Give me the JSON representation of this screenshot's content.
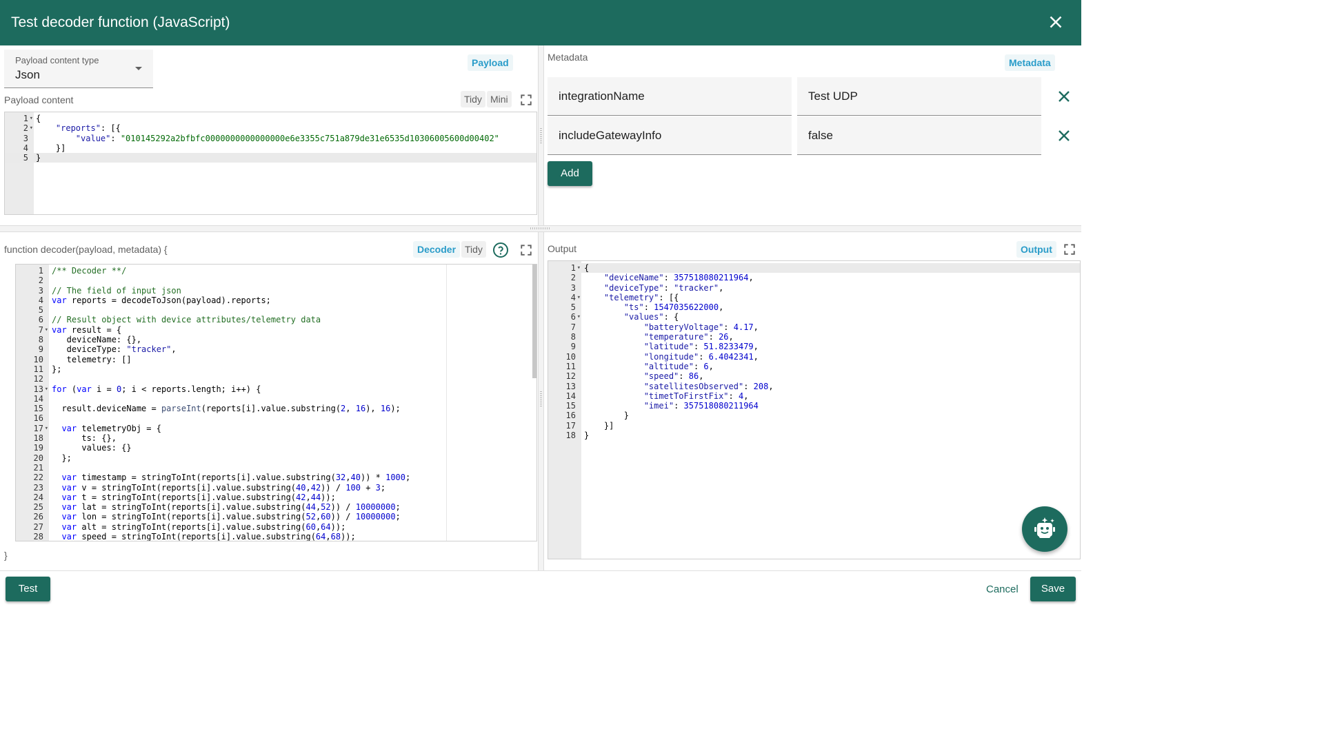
{
  "dialog": {
    "title": "Test decoder function (JavaScript)"
  },
  "payload": {
    "content_type_label": "Payload content type",
    "content_type_value": "Json",
    "chip": "Payload",
    "content_label": "Payload content",
    "tidy": "Tidy",
    "mini": "Mini",
    "line_numbers": [
      "1",
      "2",
      "3",
      "4",
      "5"
    ],
    "lines": [
      "{",
      "    \"reports\": [{",
      "        \"value\": \"010145292a2bfbfc0000000000000000e6e3355c751a879de31e6535d10306005600d00402\"",
      "    }]",
      "}"
    ]
  },
  "metadata": {
    "label": "Metadata",
    "chip": "Metadata",
    "rows": [
      {
        "key": "integrationName",
        "value": "Test UDP"
      },
      {
        "key": "includeGatewayInfo",
        "value": "false"
      }
    ],
    "add_label": "Add"
  },
  "decoder": {
    "signature": "function decoder(payload, metadata) {",
    "closing": "}",
    "chip": "Decoder",
    "tidy": "Tidy",
    "line_numbers": [
      "1",
      "2",
      "3",
      "4",
      "5",
      "6",
      "7",
      "8",
      "9",
      "10",
      "11",
      "12",
      "13",
      "14",
      "15",
      "16",
      "17",
      "18",
      "19",
      "20",
      "21",
      "22",
      "23",
      "24",
      "25",
      "26",
      "27",
      "28"
    ],
    "lines": [
      "/** Decoder **/",
      "",
      "// The field of input json",
      "var reports = decodeToJson(payload).reports;",
      "",
      "// Result object with device attributes/telemetry data",
      "var result = {",
      "   deviceName: {},",
      "   deviceType: \"tracker\",",
      "   telemetry: []",
      "};",
      "",
      "for (var i = 0; i < reports.length; i++) {",
      "",
      "  result.deviceName = parseInt(reports[i].value.substring(2, 16), 16);",
      "",
      "  var telemetryObj = {",
      "      ts: {},",
      "      values: {}",
      "  };",
      "",
      "  var timestamp = stringToInt(reports[i].value.substring(32,40)) * 1000;",
      "  var v = stringToInt(reports[i].value.substring(40,42)) / 100 + 3;",
      "  var t = stringToInt(reports[i].value.substring(42,44));",
      "  var lat = stringToInt(reports[i].value.substring(44,52)) / 10000000;",
      "  var lon = stringToInt(reports[i].value.substring(52,60)) / 10000000;",
      "  var alt = stringToInt(reports[i].value.substring(60,64));",
      "  var speed = stringToInt(reports[i].value.substring(64,68));"
    ]
  },
  "output": {
    "label": "Output",
    "chip": "Output",
    "line_numbers": [
      "1",
      "2",
      "3",
      "4",
      "5",
      "6",
      "7",
      "8",
      "9",
      "10",
      "11",
      "12",
      "13",
      "14",
      "15",
      "16",
      "17",
      "18"
    ],
    "lines": [
      "{",
      "    \"deviceName\": 357518080211964,",
      "    \"deviceType\": \"tracker\",",
      "    \"telemetry\": [{",
      "        \"ts\": 1547035622000,",
      "        \"values\": {",
      "            \"batteryVoltage\": 4.17,",
      "            \"temperature\": 26,",
      "            \"latitude\": 51.8233479,",
      "            \"longitude\": 6.4042341,",
      "            \"altitude\": 6,",
      "            \"speed\": 86,",
      "            \"satellitesObserved\": 208,",
      "            \"timetToFirstFix\": 4,",
      "            \"imei\": 357518080211964",
      "        }",
      "    }]",
      "}"
    ]
  },
  "footer": {
    "test": "Test",
    "cancel": "Cancel",
    "save": "Save"
  },
  "colors": {
    "primary": "#1d6b5e",
    "chip_text": "#2a9cc9"
  },
  "icons": [
    "close-icon",
    "fullscreen-icon",
    "help-icon",
    "delete-icon",
    "ai-assistant-icon"
  ]
}
